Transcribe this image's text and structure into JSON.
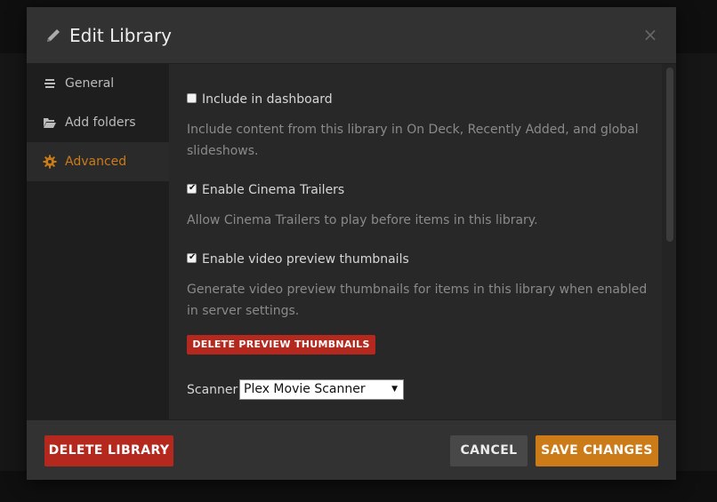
{
  "dialog": {
    "title": "Edit Library",
    "close_glyph": "×"
  },
  "sidebar": {
    "items": [
      {
        "label": "General",
        "icon": "general-lines-icon",
        "active": false
      },
      {
        "label": "Add folders",
        "icon": "folder-icon",
        "active": false
      },
      {
        "label": "Advanced",
        "icon": "gear-icon",
        "active": true
      }
    ]
  },
  "settings": {
    "include_dashboard": {
      "label": "Include in dashboard",
      "checked": false,
      "help": "Include content from this library in On Deck, Recently Added, and global slideshows."
    },
    "cinema_trailers": {
      "label": "Enable Cinema Trailers",
      "checked": true,
      "help": "Allow Cinema Trailers to play before items in this library."
    },
    "video_previews": {
      "label": "Enable video preview thumbnails",
      "checked": true,
      "help": "Generate video preview thumbnails for items in this library when enabled in server settings."
    },
    "delete_previews_label": "DELETE PREVIEW THUMBNAILS",
    "scanner": {
      "label": "Scanner",
      "value": "Plex Movie Scanner"
    }
  },
  "footer": {
    "delete_label": "DELETE LIBRARY",
    "cancel_label": "CANCEL",
    "save_label": "SAVE CHANGES"
  },
  "colors": {
    "accent": "#cc7b19",
    "danger": "#b5281d",
    "panel": "#282828",
    "header": "#323232",
    "sidebar": "#1e1e1e"
  }
}
